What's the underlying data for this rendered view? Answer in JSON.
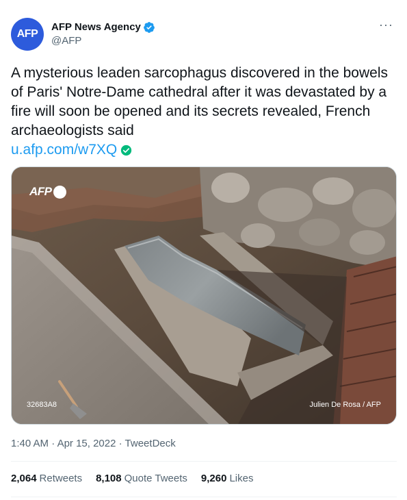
{
  "author": {
    "avatar_text": "AFP",
    "display_name": "AFP News Agency",
    "handle": "@AFP",
    "verified": true
  },
  "more_label": "···",
  "tweet": {
    "text": "A mysterious leaden sarcophagus discovered in the bowels of Paris' Notre-Dame cathedral after it was devastated by a fire will soon be opened and its secrets revealed, French archaeologists said",
    "link_text": "u.afp.com/w7XQ"
  },
  "media": {
    "logo_text": "AFP",
    "photo_id": "32683A8",
    "credit": "Julien De Rosa / AFP"
  },
  "meta": {
    "time": "1:40 AM",
    "separator": "·",
    "date": "Apr 15, 2022",
    "source": "TweetDeck"
  },
  "stats": {
    "retweets_count": "2,064",
    "retweets_label": "Retweets",
    "quotes_count": "8,108",
    "quotes_label": "Quote Tweets",
    "likes_count": "9,260",
    "likes_label": "Likes"
  },
  "colors": {
    "link": "#1d9bf0",
    "verified": "#1d9bf0",
    "avatar_bg": "#2d5bdc",
    "secondary_text": "#536471"
  }
}
